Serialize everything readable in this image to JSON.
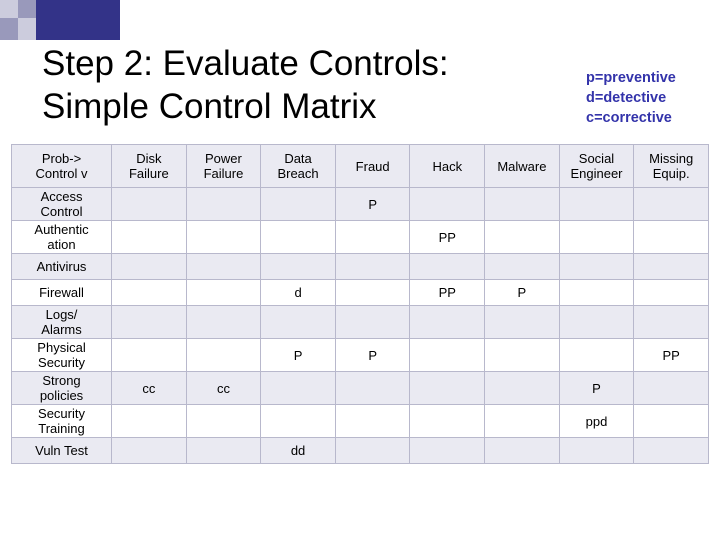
{
  "title": {
    "line1": "Step 2: Evaluate Controls:",
    "line2": "Simple Control Matrix"
  },
  "legend": {
    "line1": "p=preventive",
    "line2": "d=detective",
    "line3": "c=corrective",
    "color": "#3333aa"
  },
  "table": {
    "headers": [
      "Prob->\nControl v",
      "Disk\nFailure",
      "Power\nFailure",
      "Data\nBreach",
      "Fraud",
      "Hack",
      "Malware",
      "Social\nEngineer",
      "Missing\nEquip."
    ],
    "header_corner_line1": "Prob->",
    "header_corner_line2": "Control v",
    "header_cells": [
      {
        "line1": "Disk",
        "line2": "Failure"
      },
      {
        "line1": "Power",
        "line2": "Failure"
      },
      {
        "line1": "Data",
        "line2": "Breach"
      },
      {
        "line1": "Fraud",
        "line2": ""
      },
      {
        "line1": "Hack",
        "line2": ""
      },
      {
        "line1": "Malware",
        "line2": ""
      },
      {
        "line1": "Social",
        "line2": "Engineer"
      },
      {
        "line1": "Missing",
        "line2": "Equip."
      }
    ],
    "rows": [
      {
        "label_line1": "Access",
        "label_line2": "Control",
        "cells": [
          "",
          "",
          "",
          "P",
          "",
          "",
          "",
          ""
        ]
      },
      {
        "label_line1": "Authentic",
        "label_line2": "ation",
        "cells": [
          "",
          "",
          "",
          "",
          "PP",
          "",
          "",
          ""
        ]
      },
      {
        "label_line1": "Antivirus",
        "label_line2": "",
        "cells": [
          "",
          "",
          "",
          "",
          "",
          "",
          "",
          ""
        ]
      },
      {
        "label_line1": "Firewall",
        "label_line2": "",
        "cells": [
          "",
          "",
          "d",
          "",
          "PP",
          "P",
          "",
          ""
        ]
      },
      {
        "label_line1": "Logs/",
        "label_line2": "Alarms",
        "cells": [
          "",
          "",
          "",
          "",
          "",
          "",
          "",
          ""
        ]
      },
      {
        "label_line1": "Physical",
        "label_line2": "Security",
        "cells": [
          "",
          "",
          "P",
          "P",
          "",
          "",
          "",
          "PP"
        ]
      },
      {
        "label_line1": "Strong",
        "label_line2": "policies",
        "cells": [
          "cc",
          "cc",
          "",
          "",
          "",
          "",
          "P",
          ""
        ]
      },
      {
        "label_line1": "Security",
        "label_line2": "Training",
        "cells": [
          "",
          "",
          "",
          "",
          "",
          "",
          "ppd",
          ""
        ]
      },
      {
        "label_line1": "Vuln Test",
        "label_line2": "",
        "cells": [
          "",
          "",
          "dd",
          "",
          "",
          "",
          "",
          ""
        ]
      }
    ]
  }
}
